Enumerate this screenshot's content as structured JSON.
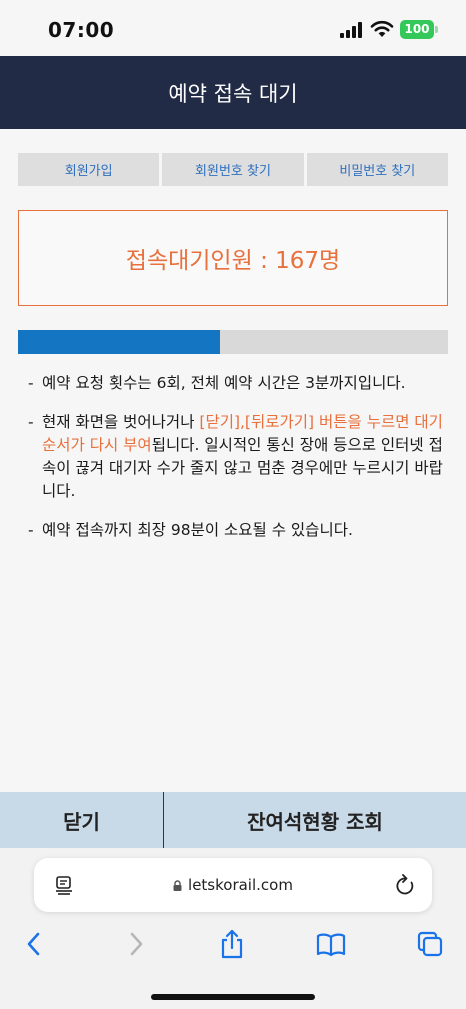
{
  "status_bar": {
    "time": "07:00",
    "battery": "100"
  },
  "header": {
    "title": "예약 접속 대기"
  },
  "tabs": [
    {
      "label": "회원가입"
    },
    {
      "label": "회원번호 찾기"
    },
    {
      "label": "비밀번호 찾기"
    }
  ],
  "queue": {
    "text": "접속대기인원 : 167명",
    "progress_percent": 47
  },
  "notices": {
    "item1": "예약 요청 횟수는 6회, 전체 예약 시간은 3분까지입니다.",
    "item2_pre": "현재 화면을 벗어나거나 ",
    "item2_highlight": "[닫기],[뒤로가기] 버튼을 누르면 대기 순서가 다시 부여",
    "item2_post": "됩니다. 일시적인 통신 장애 등으로 인터넷 접속이 끊겨 대기자 수가 줄지 않고 멈춘 경우에만 누르시기 바랍니다.",
    "item3": "예약 접속까지 최장 98분이 소요될 수 있습니다."
  },
  "buttons": {
    "close": "닫기",
    "seats": "잔여석현황 조회"
  },
  "browser": {
    "url": "letskorail.com"
  },
  "colors": {
    "header_bg": "#222b45",
    "accent_orange": "#e8703c",
    "progress_blue": "#1476c2",
    "tab_text": "#2d6fbe",
    "bottom_bar_bg": "#c8d9e8"
  }
}
